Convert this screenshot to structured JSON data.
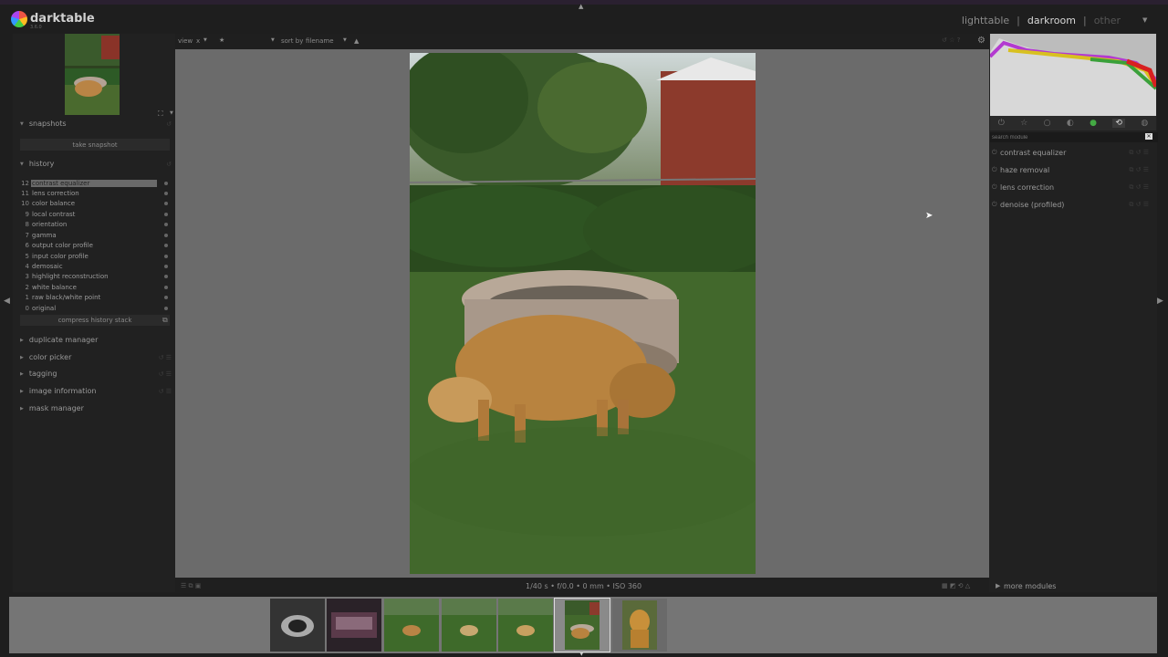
{
  "app": {
    "name": "darktable",
    "subtitle": "3.6.0"
  },
  "views": {
    "lighttable": "lighttable",
    "darkroom": "darkroom",
    "other": "other",
    "sep": "|"
  },
  "topbar": {
    "view_label": "view",
    "view_value": "x",
    "rating": "★",
    "sort_label": "sort by",
    "sort_value": "filename",
    "sort_dir": "▲"
  },
  "left": {
    "snapshots": {
      "title": "snapshots",
      "take_label": "take snapshot"
    },
    "history": {
      "title": "history",
      "items": [
        {
          "num": "12",
          "label": "contrast equalizer"
        },
        {
          "num": "11",
          "label": "lens correction"
        },
        {
          "num": "10",
          "label": "color balance"
        },
        {
          "num": "9",
          "label": "local contrast"
        },
        {
          "num": "8",
          "label": "orientation"
        },
        {
          "num": "7",
          "label": "gamma"
        },
        {
          "num": "6",
          "label": "output color profile"
        },
        {
          "num": "5",
          "label": "input color profile"
        },
        {
          "num": "4",
          "label": "demosaic"
        },
        {
          "num": "3",
          "label": "highlight reconstruction"
        },
        {
          "num": "2",
          "label": "white balance"
        },
        {
          "num": "1",
          "label": "raw black/white point"
        },
        {
          "num": "0",
          "label": "original"
        }
      ],
      "compress_label": "compress history stack"
    },
    "sections": [
      "duplicate manager",
      "color picker",
      "tagging",
      "image information",
      "mask manager"
    ]
  },
  "status": {
    "exif": "1/40 s • f/0.0 • 0 mm • ISO 360"
  },
  "right": {
    "search_placeholder": "search module",
    "modules": [
      "contrast equalizer",
      "haze removal",
      "lens correction",
      "denoise (profiled)"
    ],
    "more_modules": "more modules"
  },
  "colors": {
    "accent": "#d8d8d8",
    "panel": "#212121",
    "center": "#6b6b6b"
  }
}
